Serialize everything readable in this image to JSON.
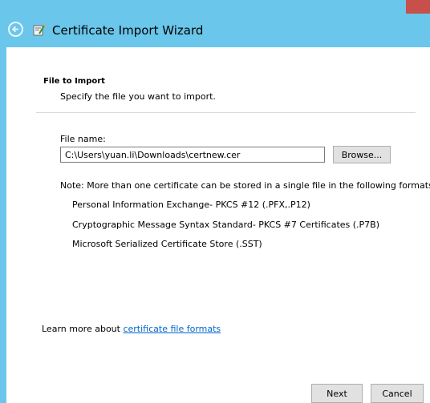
{
  "window": {
    "title": "Certificate Import Wizard"
  },
  "page": {
    "section_title": "File to Import",
    "section_description": "Specify the file you want to import."
  },
  "file": {
    "label": "File name:",
    "value": "C:\\Users\\yuan.li\\Downloads\\certnew.cer",
    "browse_label": "Browse..."
  },
  "note": {
    "text": "Note:  More than one certificate can be stored in a single file in the following formats:",
    "formats": [
      "Personal Information Exchange- PKCS #12 (.PFX,.P12)",
      "Cryptographic Message Syntax Standard- PKCS #7 Certificates (.P7B)",
      "Microsoft Serialized Certificate Store (.SST)"
    ]
  },
  "learn_more": {
    "prefix": "Learn more about",
    "link": "certificate file formats"
  },
  "buttons": {
    "next": "Next",
    "cancel": "Cancel"
  },
  "colors": {
    "titlebar": "#6ac6ea",
    "link": "#0066cc",
    "close": "#c7504a"
  },
  "icons": [
    "back-arrow-icon",
    "certificate-wizard-icon"
  ]
}
